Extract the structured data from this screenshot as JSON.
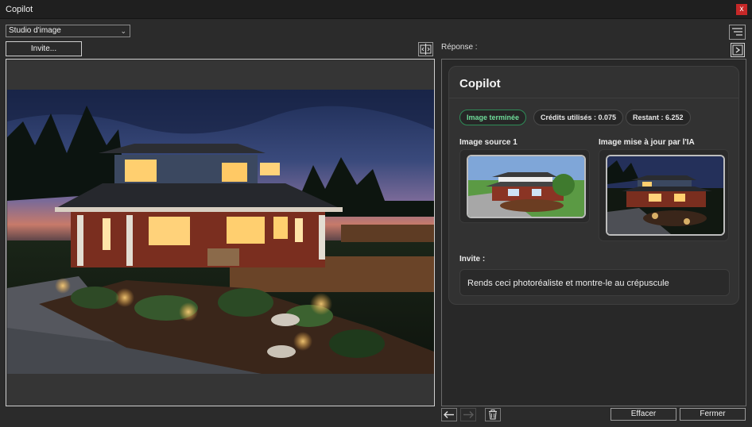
{
  "window": {
    "title": "Copilot",
    "close_glyph": "x"
  },
  "toolbar": {
    "mode_select_value": "Studio d'image",
    "invite_button_label": "Invite...",
    "compare_icon": "split-compare-icon",
    "menu_icon": "sort-lines-icon",
    "panel_toggle_icon": "chevron-right-icon"
  },
  "canvas": {
    "image_description": "twilight-house-render"
  },
  "response": {
    "label": "Réponse :",
    "card_title": "Copilot",
    "status_chip": "Image terminée",
    "credits_chip": "Crédits utilisés : 0.075",
    "remaining_chip": "Restant : 6.252",
    "source_label": "Image source 1",
    "updated_label": "Image mise à jour par l'IA",
    "prompt_label": "Invite :",
    "prompt_text": "Rends ceci photoréaliste et montre-le au crépuscule"
  },
  "footer": {
    "back_icon": "arrow-left-icon",
    "forward_icon": "arrow-right-icon",
    "trash_icon": "trash-icon",
    "clear_label": "Effacer",
    "close_label": "Fermer"
  },
  "colors": {
    "background": "#2b2b2b",
    "titlebar": "#1f1f1f",
    "accent_success": "#6fdc9a",
    "close_red": "#c62828"
  }
}
